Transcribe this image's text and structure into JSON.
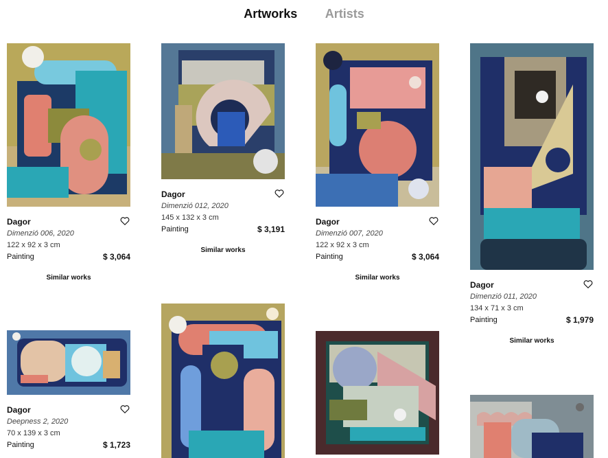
{
  "tabs": [
    {
      "label": "Artworks",
      "active": true
    },
    {
      "label": "Artists",
      "active": false
    }
  ],
  "cards": [
    {
      "artist": "Dagor",
      "title": "Dimenzió 006, 2020",
      "dims": "122 x 92 x 3 cm",
      "medium": "Painting",
      "price": "$ 3,064",
      "similar": "Similar works"
    },
    {
      "artist": "Dagor",
      "title": "Dimenzió 012, 2020",
      "dims": "145 x 132 x 3 cm",
      "medium": "Painting",
      "price": "$ 3,191",
      "similar": "Similar works"
    },
    {
      "artist": "Dagor",
      "title": "Dimenzió 007, 2020",
      "dims": "122 x 92 x 3 cm",
      "medium": "Painting",
      "price": "$ 3,064",
      "similar": "Similar works"
    },
    {
      "artist": "Dagor",
      "title": "Dimenzió 011, 2020",
      "dims": "134 x 71 x 3 cm",
      "medium": "Painting",
      "price": "$ 1,979",
      "similar": "Similar works"
    },
    {
      "artist": "Dagor",
      "title": "Deepness 2, 2020",
      "dims": "70 x 139 x 3 cm",
      "medium": "Painting",
      "price": "$ 1,723"
    }
  ],
  "icons": {
    "favorite": "heart-outline-icon"
  },
  "colors": {
    "inactive_tab": "#9a9a9a",
    "text": "#111111"
  }
}
